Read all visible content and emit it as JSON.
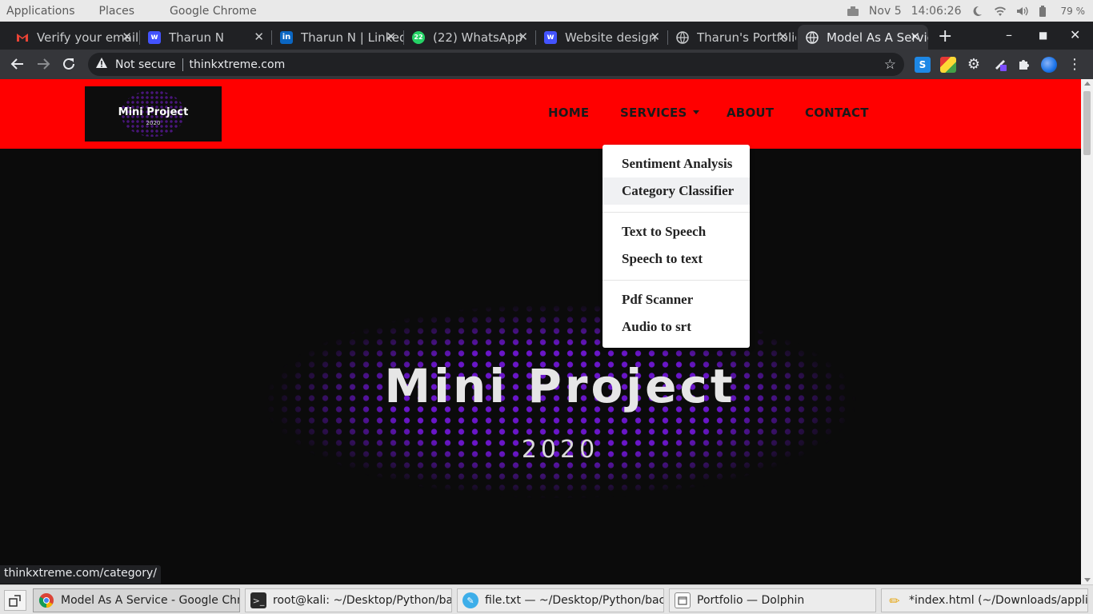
{
  "system_panel": {
    "menus": [
      "Applications",
      "Places",
      "Google Chrome"
    ],
    "date": "Nov 5",
    "time": "14:06:26",
    "battery": "79 %"
  },
  "browser": {
    "tabs": [
      {
        "label": "Verify your email",
        "icon": "gmail-icon"
      },
      {
        "label": "Tharun N",
        "icon": "webflow-icon"
      },
      {
        "label": "Tharun N | LinkedIn",
        "icon": "linkedin-icon"
      },
      {
        "label": "(22) WhatsApp",
        "icon": "whatsapp-icon"
      },
      {
        "label": "Website design",
        "icon": "webflow-icon"
      },
      {
        "label": "Tharun's Portfolio",
        "icon": "globe-icon"
      },
      {
        "label": "Model As A Service",
        "icon": "globe-icon"
      }
    ],
    "security_label": "Not secure",
    "url": "thinkxtreme.com",
    "status_url": "thinkxtreme.com/category/"
  },
  "site": {
    "logo_title": "Mini Project",
    "logo_year": "2020",
    "nav": {
      "home": "HOME",
      "services": "SERVICES",
      "about": "ABOUT",
      "contact": "CONTACT"
    },
    "services_menu": [
      "Sentiment Analysis",
      "Category Classifier",
      "Text to Speech",
      "Speech to text",
      "Pdf Scanner",
      "Audio to srt"
    ],
    "hero_title": "Mini Project",
    "hero_year": "2020",
    "header_color": "#ff0000",
    "accent_color": "#6a16c9"
  },
  "taskbar": {
    "tasks": [
      {
        "label": "Model As A Service - Google Chrome",
        "icon": "chrome-icon"
      },
      {
        "label": "root@kali: ~/Desktop/Python/back...",
        "icon": "terminal-icon"
      },
      {
        "label": "file.txt — ~/Desktop/Python/back...",
        "icon": "kate-icon"
      },
      {
        "label": "Portfolio — Dolphin",
        "icon": "dolphin-icon"
      },
      {
        "label": "*index.html (~/Downloads/applica...",
        "icon": "editor-icon"
      }
    ]
  }
}
